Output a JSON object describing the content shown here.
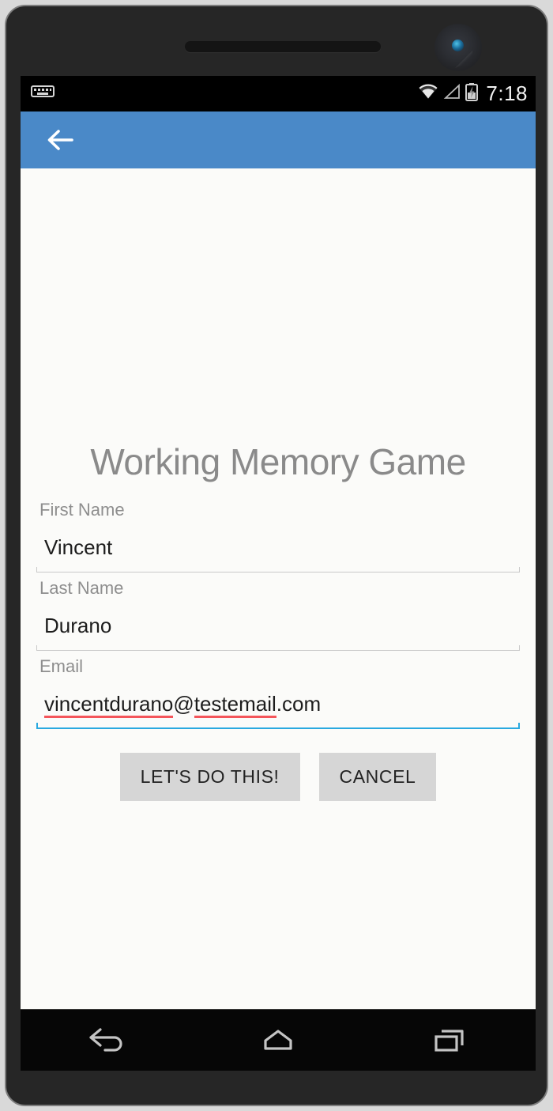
{
  "device": {
    "speaker_name": "earpiece-speaker",
    "camera_name": "front-camera"
  },
  "status_bar": {
    "keyboard_icon": "keyboard-icon",
    "wifi_icon": "wifi-icon",
    "signal_icon": "cell-signal-icon",
    "battery_icon": "battery-charging-icon",
    "time": "7:18",
    "background": "#000000"
  },
  "app_bar": {
    "back_icon": "back-arrow-icon",
    "background": "#4a89c8"
  },
  "page": {
    "title": "Working Memory Game",
    "title_color": "#8a8a8a",
    "background": "#fbfbf9"
  },
  "form": {
    "fields": [
      {
        "label": "First Name",
        "value": "Vincent",
        "placeholder": "First Name",
        "focused": false,
        "name": "first-name"
      },
      {
        "label": "Last Name",
        "value": "Durano",
        "placeholder": "Last Name",
        "focused": false,
        "name": "last-name"
      },
      {
        "label": "Email",
        "value": "vincentdurano@testemail.com",
        "placeholder": "Email",
        "focused": true,
        "name": "email",
        "misspelled_parts": [
          "vincentdurano",
          "testemail"
        ],
        "focus_color": "#29a9e0",
        "spellcheck_color": "#f4555a"
      }
    ]
  },
  "buttons": {
    "submit_label": "LET'S DO THIS!",
    "cancel_label": "CANCEL",
    "background": "#d6d6d6"
  },
  "nav_bar": {
    "back_icon": "nav-back-icon",
    "home_icon": "nav-home-icon",
    "recents_icon": "nav-recents-icon",
    "background": "#060606"
  }
}
